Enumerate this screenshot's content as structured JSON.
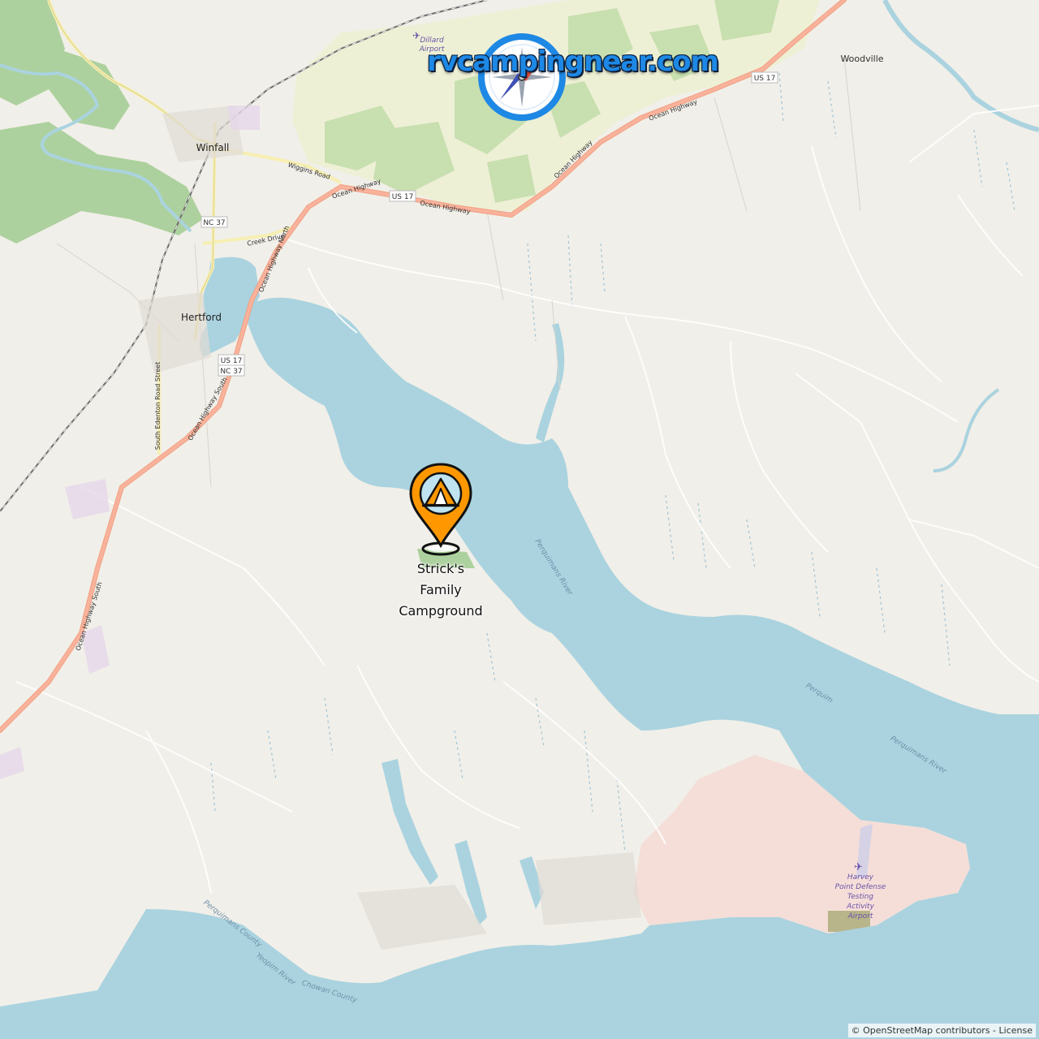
{
  "brand": {
    "text": "rvcampingnear.com",
    "icon": "compass-icon",
    "colors": {
      "ring": "#1e88e5",
      "needle_red": "#e74c3c",
      "needle_blue": "#3f51b5"
    }
  },
  "marker": {
    "icon": "tent-icon",
    "name_lines": [
      "Strick's",
      "Family",
      "Campground"
    ],
    "color": "#ff9800"
  },
  "places": {
    "winfall": "Winfall",
    "hertford": "Hertford",
    "woodville": "Woodville"
  },
  "roads": {
    "wiggins": "Wiggins Road",
    "creek": "Creek Drive",
    "ocean_hwy": "Ocean Highway",
    "ocean_hwy_north": "Ocean Highway North",
    "ocean_hwy_south": "Ocean Highway South",
    "south_edenton": "South Edenton Road Street"
  },
  "shields": {
    "us17": "US 17",
    "nc37": "NC 37"
  },
  "waters": {
    "perquimans_river": "Perquimans River",
    "perquim": "Perquim",
    "yeopim": "Yeopim River",
    "perquimans_county": "Perquimans County",
    "chowan_county": "Chowan County"
  },
  "airports": {
    "dillard": [
      "Dillard",
      "Airport"
    ],
    "harvey": [
      "Harvey",
      "Point Defense",
      "Testing",
      "Activity",
      "Airport"
    ]
  },
  "attribution": {
    "symbol": "©",
    "osm": "OpenStreetMap contributors",
    "separator": " - ",
    "license": "License"
  },
  "map_colors": {
    "land": "#f1efe9",
    "water": "#aad3df",
    "forest": "#add19e",
    "farmland": "#eef0d5",
    "military": "#f5ded8",
    "trunk": "#f0a080"
  }
}
